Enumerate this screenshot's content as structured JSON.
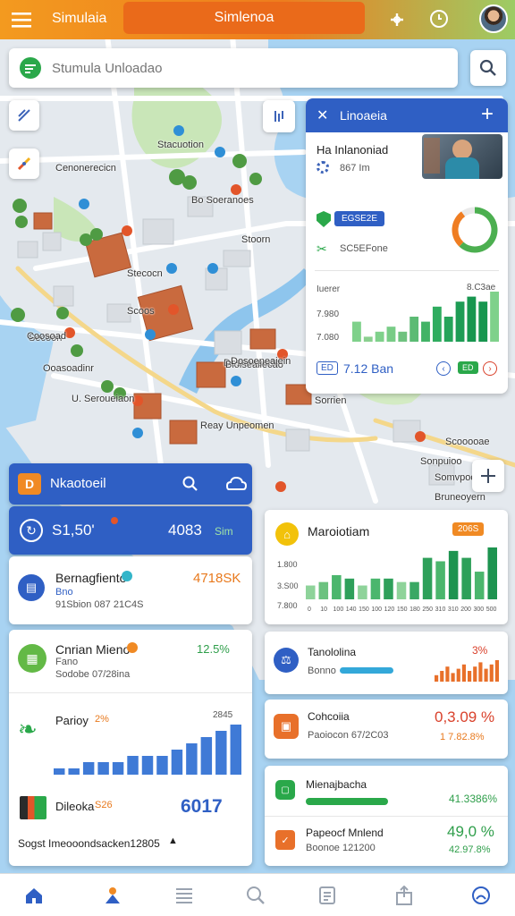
{
  "app": {
    "title": "Simulaia",
    "center_title": "Simlenoa"
  },
  "search": {
    "placeholder": "Stumula Unloadao"
  },
  "map_labels": [
    "Stacuotion",
    "Cenonerecicn",
    "Bo Soeranoes",
    "Stoorn",
    "Stecocn",
    "Scoos",
    "Secoon",
    "Ooasoadinr",
    "Coosoad",
    "Dosrioaoeds",
    "Bloisealiecao",
    "Dosoeneaiein",
    "U. Seroueiaon",
    "Reay Unpeomen",
    "Sorrien",
    "Scooooae",
    "Somvpoop",
    "Bruneoyern",
    "Sonpuioo"
  ],
  "panel_top": {
    "title": "Linoaeia",
    "row1_title": "Ha Inlanoniad",
    "row1_sub": "867 Im",
    "row2_badge": "EGSE2E",
    "row2_sub": "SC5EFone",
    "chart_ylabels": [
      "Iuerer",
      "7.980",
      "7.080"
    ],
    "chart_toplabel": "8.C3ae",
    "footer_badge": "ED",
    "footer_value": "7.12 Ban",
    "footer_tag": "ED",
    "donut": {
      "segments": [
        {
          "value": 62,
          "color": "#4caf50"
        },
        {
          "value": 28,
          "color": "#ef7d22"
        },
        {
          "value": 10,
          "color": "#e9e9e9"
        }
      ]
    },
    "chart_data": {
      "type": "bar",
      "values": [
        4,
        1,
        2,
        3,
        2,
        5,
        4,
        7,
        5,
        8,
        9,
        8,
        10
      ],
      "colors": [
        "#7fd18b",
        "#8ad08f",
        "#7fd18b",
        "#78cc86",
        "#6fc27f",
        "#5cbb74",
        "#42b366",
        "#2fac5f",
        "#26a45a",
        "#1e9c55",
        "#17964f",
        "#17964f",
        "#7fd18b"
      ]
    }
  },
  "left_header": {
    "title": "Nkaotoeil"
  },
  "stat_row": {
    "left": "S1,50'",
    "right": "4083",
    "right_sub": "Sim"
  },
  "list_left": [
    {
      "title": "Bernagfiento",
      "sub1": "Bno",
      "sub2": "91Sbion 087 21C4S",
      "value": "4718SK"
    },
    {
      "title": "Cnrian Mieno",
      "sub1": "Fano",
      "sub2": "Sodobe 07/28ina",
      "value": "12.5%"
    }
  ],
  "bars_left": {
    "title": "Parioy",
    "badge": "2%",
    "top": "2845",
    "chart_data": {
      "type": "bar",
      "values": [
        1,
        1,
        2,
        2,
        2,
        3,
        3,
        3,
        4,
        5,
        6,
        7,
        8
      ],
      "color": "#3f7ad6"
    }
  },
  "dileoka": {
    "title": "Dileoka",
    "badge": "S26",
    "value": "6017",
    "footer": "Sogst Imeooondsacken12805"
  },
  "right_cards": [
    {
      "title": "Maroiotiam",
      "badge": "206S",
      "ylabels": [
        "1.800",
        "3.S00",
        "7.800"
      ],
      "xlabels": [
        "0",
        "10",
        "100",
        "140",
        "150",
        "100",
        "120",
        "150",
        "180",
        "250",
        "310",
        "310",
        "200",
        "300",
        "500"
      ],
      "chart_data": {
        "type": "bar",
        "values": [
          4,
          5,
          7,
          6,
          4,
          6,
          6,
          5,
          5,
          12,
          11,
          14,
          12,
          8,
          15
        ],
        "colors": [
          "#8ed39a",
          "#6cc27f",
          "#4bb66d",
          "#2ea05a",
          "#8ed39a",
          "#4bb66d",
          "#2ea05a",
          "#8ed39a",
          "#3aa864",
          "#2ea05a",
          "#4bb66d",
          "#1e9450",
          "#2ea05a",
          "#4bb66d",
          "#1e9450"
        ]
      }
    },
    {
      "title": "Tanololina",
      "sub": "Bonno",
      "value": "3%",
      "chart_data": {
        "type": "bar",
        "values": [
          3,
          5,
          7,
          4,
          6,
          8,
          5,
          7,
          9,
          6,
          8,
          10
        ],
        "color": "#e8702a"
      }
    },
    {
      "title": "Cohcoiia",
      "sub": "Paoiocon 67/2C03",
      "value": "0,3.09 %",
      "value2": "1 7.82.8%"
    },
    {
      "title": "Mienajbacha",
      "value": "41.3386%"
    },
    {
      "title": "Papeocf Mnlend",
      "sub": "Boonoe 121200",
      "value": "49,0 %",
      "value2": "42.97.8%"
    }
  ]
}
